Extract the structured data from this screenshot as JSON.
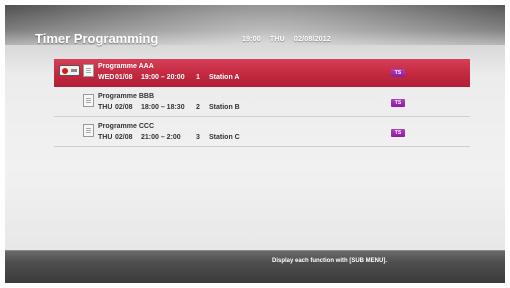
{
  "header": {
    "title": "Timer Programming",
    "clock": {
      "time": "19:00",
      "day": "THU",
      "date": "02/08/2012"
    }
  },
  "programmes": [
    {
      "name": "Programme AAA",
      "day": "WED",
      "date": "01/08",
      "time": "19:00 – 20:00",
      "channel": "1",
      "station": "Station A",
      "badge": "TS",
      "selected": true,
      "recording": true
    },
    {
      "name": "Programme BBB",
      "day": "THU",
      "date": "02/08",
      "time": "18:00 – 18:30",
      "channel": "2",
      "station": "Station B",
      "badge": "TS",
      "selected": false,
      "recording": false
    },
    {
      "name": "Programme CCC",
      "day": "THU",
      "date": "02/08",
      "time": "21:00 – 2:00",
      "channel": "3",
      "station": "Station C",
      "badge": "TS",
      "selected": false,
      "recording": false
    }
  ],
  "footer": {
    "hint": "Display each function with [SUB MENU]."
  },
  "icons": {
    "record": "rec-icon",
    "document": "document-icon"
  },
  "colors": {
    "selected_row": "#c42940",
    "badge": "#9a2aac",
    "top_band": "#5a5a5a",
    "bottom_bar": "#444444"
  }
}
